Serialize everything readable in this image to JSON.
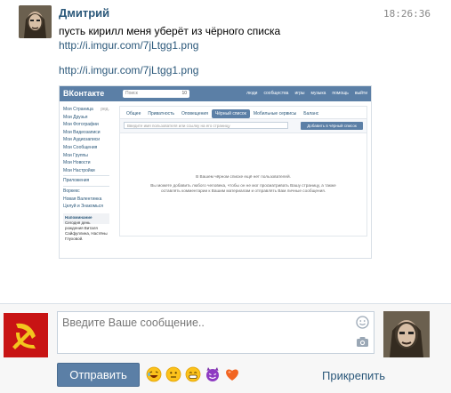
{
  "message": {
    "sender": "Дмитрий",
    "time": "18:26:36",
    "text": "пусть кирилл меня уберёт из чёрного списка",
    "link_top": "http://i.imgur.com/7jLtgg1.png",
    "link_bottom": "http://i.imgur.com/7jLtgg1.png"
  },
  "embedded_screenshot": {
    "logo": "ВКонтакте",
    "search_placeholder": "Поиск",
    "search_count": "10",
    "nav": [
      "люди",
      "сообщества",
      "игры",
      "музыка",
      "помощь",
      "выйти"
    ],
    "sidebar": [
      "Моя Страница",
      "Мои Друзья",
      "Мои Фотографии",
      "Мои Видеозаписи",
      "Мои Аудиозаписи",
      "Мои Сообщения",
      "Мои Группы",
      "Мои Новости",
      "Мои Настройки"
    ],
    "sidebar_edit": "ред.",
    "sidebar_extra": [
      "Приложения",
      "Воркекс",
      "Новая Валентинка",
      "Целуй и Знакомься"
    ],
    "note_title": "Напоминание",
    "note_text": "Сегодня день рождения Виталя Сайфуллина, Настёны Глуховой.",
    "tabs": [
      "Общее",
      "Приватность",
      "Оповещения",
      "Чёрный список",
      "Мобильные сервисы",
      "Баланс"
    ],
    "active_tab": "Чёрный список",
    "block_input_placeholder": "Введите имя пользователя или ссылку на его страницу",
    "add_button": "Добавить в чёрный список",
    "empty_title": "В Вашем чёрном списке ещё нет пользователей.",
    "empty_text_1": "Вы можете добавить любого человека, чтобы он не мог просматривать Вашу страницу, а также",
    "empty_text_2": "оставлять комментарии к Вашим материалам и отправлять Вам личные сообщения."
  },
  "composer": {
    "placeholder": "Введите Ваше сообщение..",
    "send_label": "Отправить",
    "attach_label": "Прикрепить",
    "emojis": [
      "laughing-emoji-icon",
      "neutral-emoji-icon",
      "grinning-emoji-icon",
      "devil-emoji-icon",
      "heart-icon"
    ]
  },
  "colors": {
    "link": "#2b587a",
    "button": "#5b7fa6",
    "avatar_background": "#c81414"
  }
}
